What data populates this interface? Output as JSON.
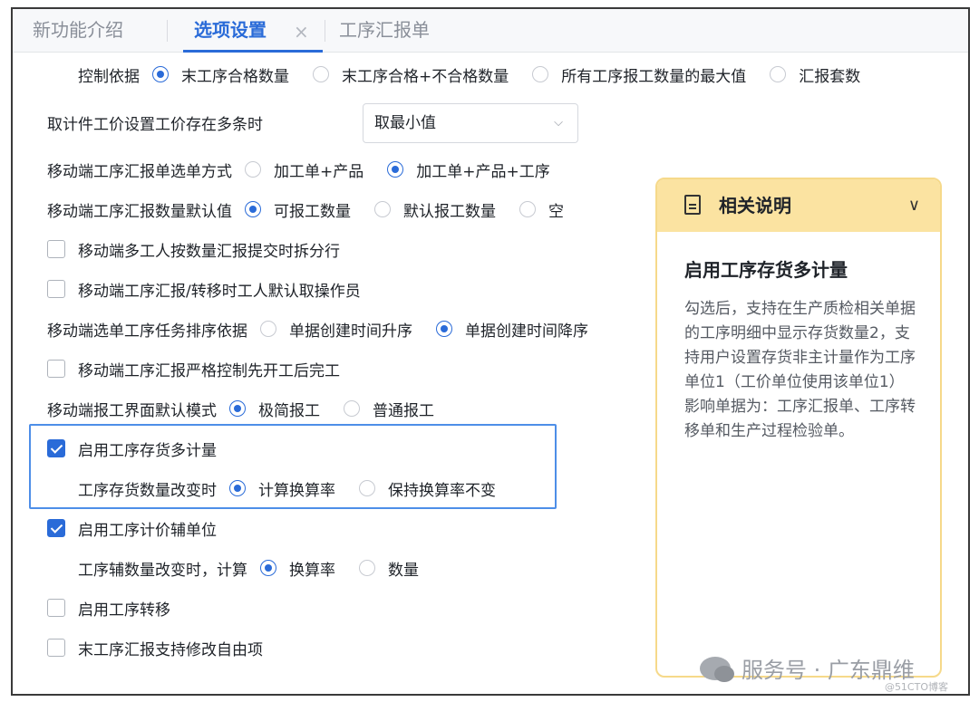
{
  "tabs": [
    {
      "label": "新功能介绍"
    },
    {
      "label": "选项设置",
      "close": "×"
    },
    {
      "label": "工序汇报单"
    }
  ],
  "settings": {
    "control_basis": {
      "label": "控制依据",
      "options": [
        "末工序合格数量",
        "末工序合格+不合格数量",
        "所有工序报工数量的最大值",
        "汇报套数"
      ],
      "selected": 0
    },
    "piece_rate": {
      "label": "取计件工价设置工价存在多条时",
      "value": "取最小值",
      "chevron": "⌵"
    },
    "mobile_select_mode": {
      "label": "移动端工序汇报单选单方式",
      "options": [
        "加工单+产品",
        "加工单+产品+工序"
      ],
      "selected": 1
    },
    "mobile_qty_default": {
      "label": "移动端工序汇报数量默认值",
      "options": [
        "可报工数量",
        "默认报工数量",
        "空"
      ],
      "selected": 0
    },
    "cb_split_rows": {
      "label": "移动端多工人按数量汇报提交时拆分行",
      "checked": false
    },
    "cb_default_operator": {
      "label": "移动端工序汇报/转移时工人默认取操作员",
      "checked": false
    },
    "mobile_sort": {
      "label": "移动端选单工序任务排序依据",
      "options": [
        "单据创建时间升序",
        "单据创建时间降序"
      ],
      "selected": 1
    },
    "cb_strict_control": {
      "label": "移动端工序汇报严格控制先开工后完工",
      "checked": false
    },
    "mobile_report_mode": {
      "label": "移动端报工界面默认模式",
      "options": [
        "极简报工",
        "普通报工"
      ],
      "selected": 0
    },
    "cb_multi_unit": {
      "label": "启用工序存货多计量",
      "checked": true
    },
    "qty_change": {
      "label": "工序存货数量改变时",
      "options": [
        "计算换算率",
        "保持换算率不变"
      ],
      "selected": 0
    },
    "cb_aux_unit": {
      "label": "启用工序计价辅单位",
      "checked": true
    },
    "aux_change": {
      "label": "工序辅数量改变时，计算",
      "options": [
        "换算率",
        "数量"
      ],
      "selected": 0
    },
    "cb_transfer": {
      "label": "启用工序转移",
      "checked": false
    },
    "cb_free_items": {
      "label": "末工序汇报支持修改自由项",
      "checked": false
    }
  },
  "panel": {
    "title": "相关说明",
    "chevron": "∨",
    "heading": "启用工序存货多计量",
    "body": "勾选后，支持在生产质检相关单据的工序明细中显示存货数量2，支持用户设置存货非主计量作为工序单位1（工价单位使用该单位1）\n影响单据为：工序汇报单、工序转移单和生产过程检验单。"
  },
  "watermark": {
    "text": "服务号 · 广东鼎维",
    "small": "@51CTO博客"
  },
  "colors": {
    "accent": "#2a6bd8",
    "panel_header": "#fbe3a1",
    "highlight_border": "#4d8ee8"
  }
}
